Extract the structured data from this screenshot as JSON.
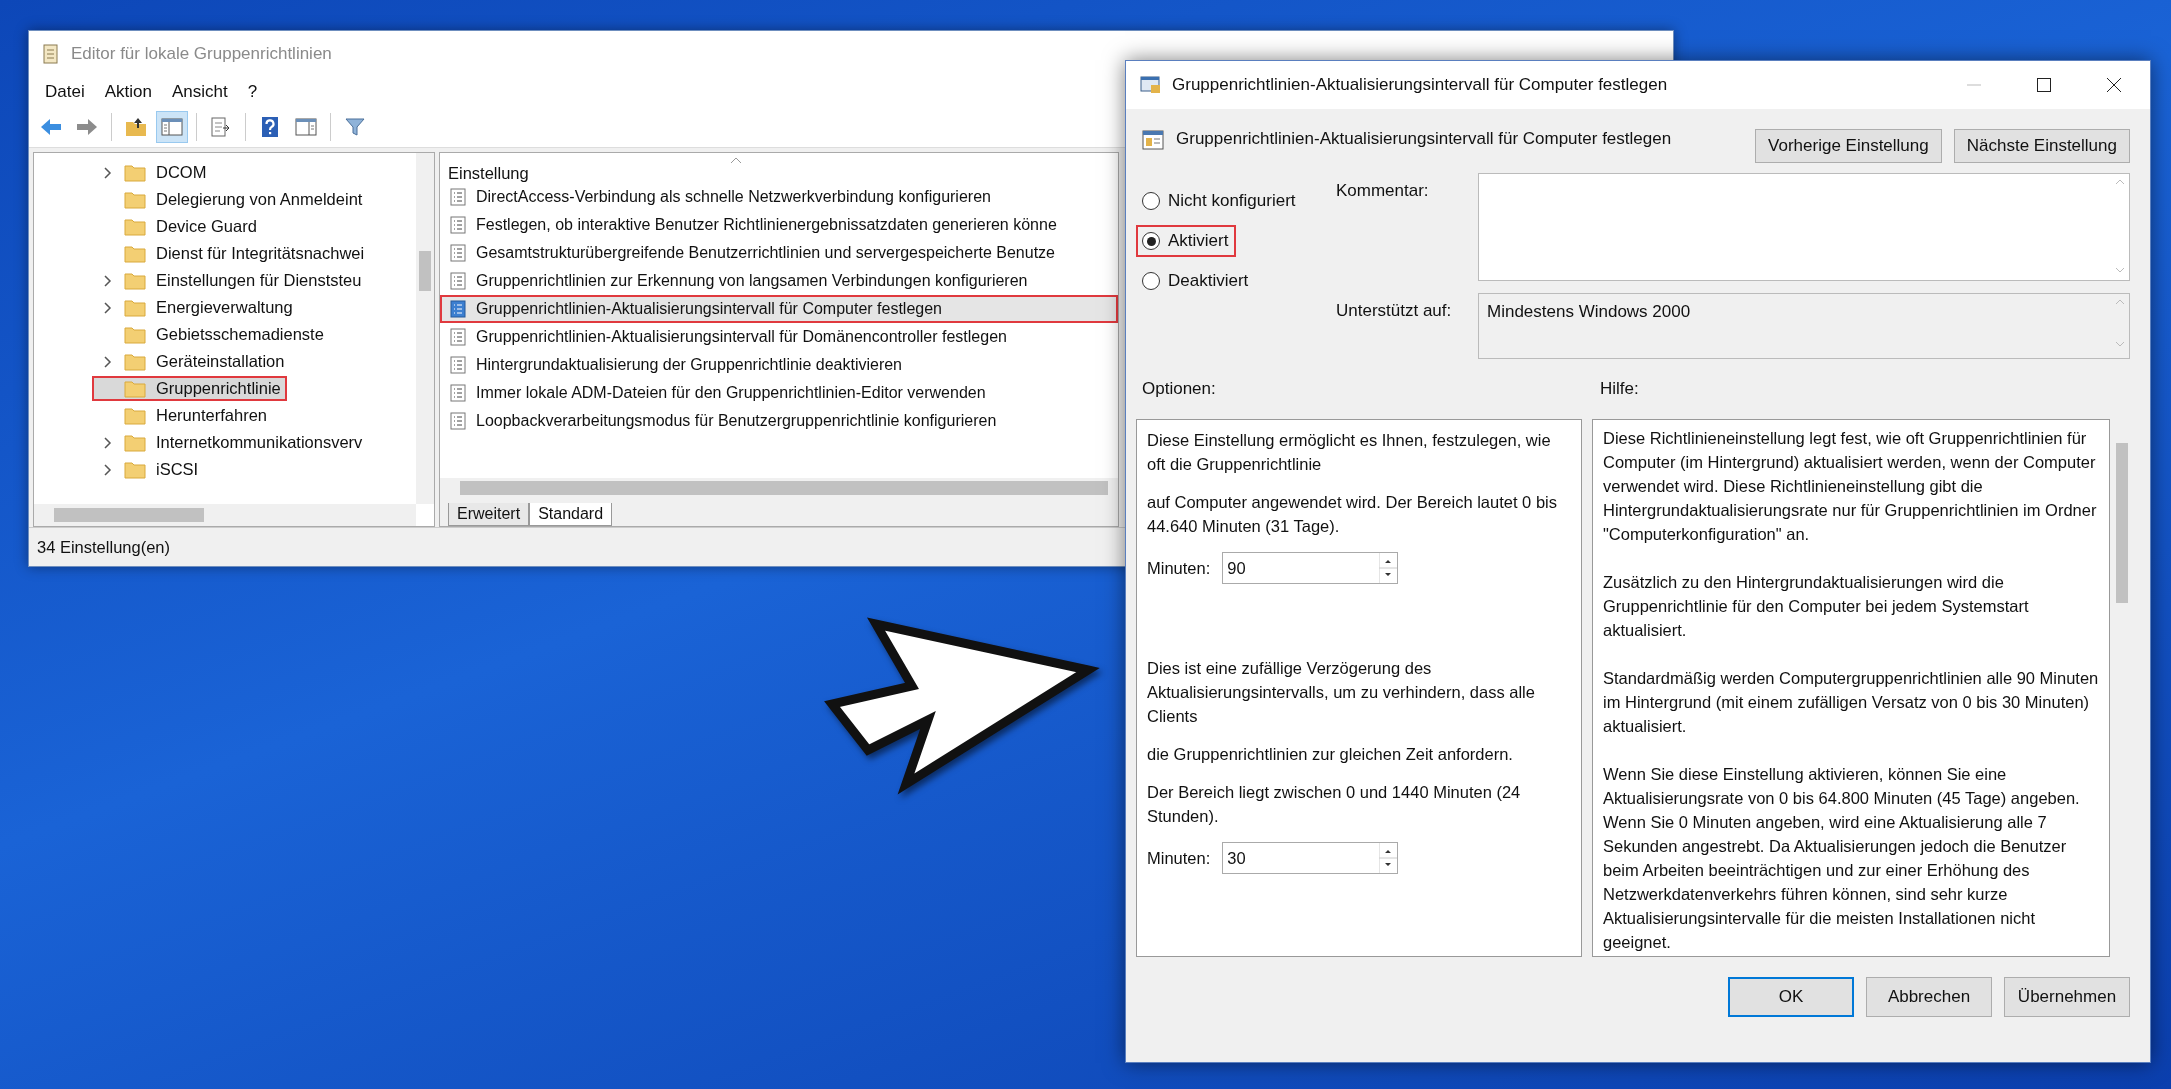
{
  "editor_window": {
    "title": "Editor für lokale Gruppenrichtlinien",
    "menu": [
      "Datei",
      "Aktion",
      "Ansicht",
      "?"
    ],
    "toolbar": [
      [
        {
          "kind": "back",
          "pressed": false
        },
        {
          "kind": "forward",
          "pressed": false
        }
      ],
      [
        {
          "kind": "folder-up",
          "pressed": false
        },
        {
          "kind": "tree",
          "pressed": true
        }
      ],
      [
        {
          "kind": "export",
          "pressed": false
        }
      ],
      [
        {
          "kind": "help",
          "pressed": false
        },
        {
          "kind": "properties",
          "pressed": false
        }
      ],
      [
        {
          "kind": "filter",
          "pressed": false
        }
      ]
    ],
    "tree": [
      {
        "label": "DCOM",
        "expandable": true,
        "selected": false,
        "highlighted": false
      },
      {
        "label": "Delegierung von Anmeldeint",
        "expandable": false,
        "selected": false,
        "highlighted": false
      },
      {
        "label": "Device Guard",
        "expandable": false,
        "selected": false,
        "highlighted": false
      },
      {
        "label": "Dienst für Integritätsnachwei",
        "expandable": false,
        "selected": false,
        "highlighted": false
      },
      {
        "label": "Einstellungen für Dienststeu",
        "expandable": true,
        "selected": false,
        "highlighted": false
      },
      {
        "label": "Energieverwaltung",
        "expandable": true,
        "selected": false,
        "highlighted": false
      },
      {
        "label": "Gebietsschemadienste",
        "expandable": false,
        "selected": false,
        "highlighted": false
      },
      {
        "label": "Geräteinstallation",
        "expandable": true,
        "selected": false,
        "highlighted": false
      },
      {
        "label": "Gruppenrichtlinie",
        "expandable": false,
        "selected": true,
        "highlighted": true
      },
      {
        "label": "Herunterfahren",
        "expandable": false,
        "selected": false,
        "highlighted": false
      },
      {
        "label": "Internetkommunikationsverv",
        "expandable": true,
        "selected": false,
        "highlighted": false
      },
      {
        "label": "iSCSI",
        "expandable": true,
        "selected": false,
        "highlighted": false
      }
    ],
    "list": {
      "column": "Einstellung",
      "items": [
        {
          "label": "DirectAccess-Verbindung als schnelle Netzwerkverbindung konfigurieren",
          "selected": false,
          "highlighted": false
        },
        {
          "label": "Festlegen, ob interaktive Benutzer Richtlinienergebnissatzdaten generieren könne",
          "selected": false,
          "highlighted": false
        },
        {
          "label": "Gesamtstrukturübergreifende Benutzerrichtlinien und servergespeicherte Benutze",
          "selected": false,
          "highlighted": false
        },
        {
          "label": "Gruppenrichtlinien zur Erkennung von langsamen Verbindungen konfigurieren",
          "selected": false,
          "highlighted": false
        },
        {
          "label": "Gruppenrichtlinien-Aktualisierungsintervall für Computer festlegen",
          "selected": true,
          "highlighted": true
        },
        {
          "label": "Gruppenrichtlinien-Aktualisierungsintervall für Domänencontroller festlegen",
          "selected": false,
          "highlighted": false
        },
        {
          "label": "Hintergrundaktualisierung der Gruppenrichtlinie deaktivieren",
          "selected": false,
          "highlighted": false
        },
        {
          "label": "Immer lokale ADM-Dateien für den Gruppenrichtlinien-Editor verwenden",
          "selected": false,
          "highlighted": false
        },
        {
          "label": "Loopbackverarbeitungsmodus für Benutzergruppenrichtlinie konfigurieren",
          "selected": false,
          "highlighted": false
        }
      ]
    },
    "tabs": [
      {
        "label": "Erweitert",
        "selected": false
      },
      {
        "label": "Standard",
        "selected": true
      }
    ],
    "status_bar": "34 Einstellung(en)"
  },
  "dialog": {
    "title": "Gruppenrichtlinien-Aktualisierungsintervall für Computer festlegen",
    "heading": "Gruppenrichtlinien-Aktualisierungsintervall für Computer festlegen",
    "nav_buttons": [
      "Vorherige Einstellung",
      "Nächste Einstellung"
    ],
    "states": [
      {
        "label": "Nicht konfiguriert",
        "selected": false,
        "highlighted": false
      },
      {
        "label": "Aktiviert",
        "selected": true,
        "highlighted": true
      },
      {
        "label": "Deaktiviert",
        "selected": false,
        "highlighted": false
      }
    ],
    "comment_label": "Kommentar:",
    "supported": {
      "label": "Unterstützt auf:",
      "value": "Mindestens Windows 2000"
    },
    "options_label": "Optionen:",
    "help_label": "Hilfe:",
    "options": [
      {
        "kind": "text",
        "text": "Diese Einstellung ermöglicht es Ihnen, festzulegen, wie oft die Gruppenrichtlinie"
      },
      {
        "kind": "text",
        "text": "auf Computer angewendet wird. Der Bereich lautet 0 bis 44.640 Minuten (31 Tage)."
      },
      {
        "kind": "spin",
        "label": "Minuten:",
        "value": "90"
      },
      {
        "kind": "text",
        "text": "Dies ist eine zufällige Verzögerung des Aktualisierungsintervalls, um zu verhindern, dass alle Clients"
      },
      {
        "kind": "text",
        "text": "die Gruppenrichtlinien zur gleichen Zeit anfordern."
      },
      {
        "kind": "text",
        "text": "Der Bereich liegt zwischen 0 und 1440 Minuten (24 Stunden)."
      },
      {
        "kind": "spin",
        "label": "Minuten:",
        "value": "30"
      }
    ],
    "help": [
      "Diese Richtlinieneinstellung legt fest, wie oft Gruppenrichtlinien für Computer (im Hintergrund) aktualisiert werden, wenn der Computer verwendet wird. Diese Richtlinieneinstellung gibt die Hintergrundaktualisierungsrate nur für Gruppenrichtlinien im Ordner \"Computerkonfiguration\" an.",
      "Zusätzlich zu den Hintergrundaktualisierungen wird die Gruppenrichtlinie für den Computer bei jedem Systemstart aktualisiert.",
      "Standardmäßig werden Computergruppenrichtlinien alle 90 Minuten im Hintergrund (mit einem zufälligen Versatz von 0 bis 30 Minuten) aktualisiert.",
      "Wenn Sie diese Einstellung aktivieren, können Sie eine Aktualisierungsrate von 0 bis 64.800 Minuten (45 Tage) angeben. Wenn Sie 0 Minuten angeben, wird eine Aktualisierung alle 7 Sekunden angestrebt. Da Aktualisierungen jedoch die Benutzer beim Arbeiten beeinträchtigen und zur einer Erhöhung des Netzwerkdatenverkehrs führen können, sind sehr kurze Aktualisierungsintervalle für die meisten Installationen nicht geeignet."
    ],
    "buttons": [
      {
        "label": "OK",
        "default": true
      },
      {
        "label": "Abbrechen",
        "default": false
      },
      {
        "label": "Übernehmen",
        "default": false
      }
    ]
  }
}
